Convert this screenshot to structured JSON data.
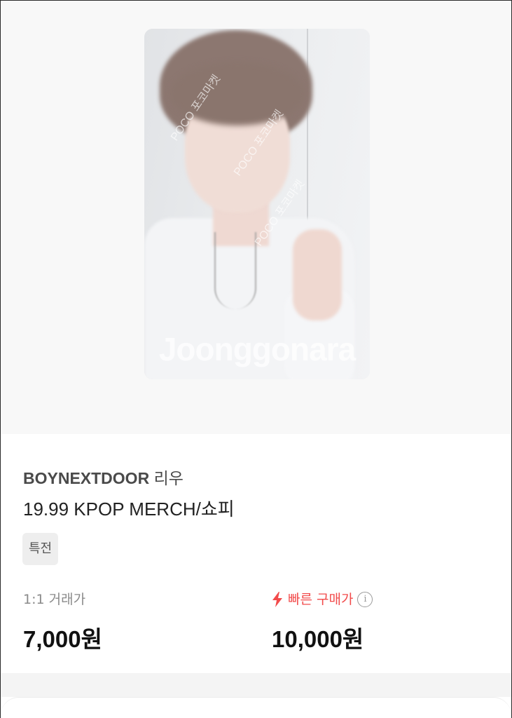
{
  "product": {
    "image": {
      "watermark": "Joonggonara",
      "watermark_small": "POCO 포코마켓"
    },
    "title_brand": "BOYNEXTDOOR",
    "title_member": "리우",
    "subtitle": "19.99 KPOP MERCH/쇼피",
    "tag": "특전",
    "prices": {
      "direct_label": "1:1 거래가",
      "direct_value": "7,000원",
      "fast_label": "빠른 구매가",
      "fast_value": "10,000원",
      "fast_color": "#f24b4b"
    }
  },
  "icons": {
    "fast_purchase": "lightning-bolt-icon",
    "info": "info-circle-icon"
  }
}
